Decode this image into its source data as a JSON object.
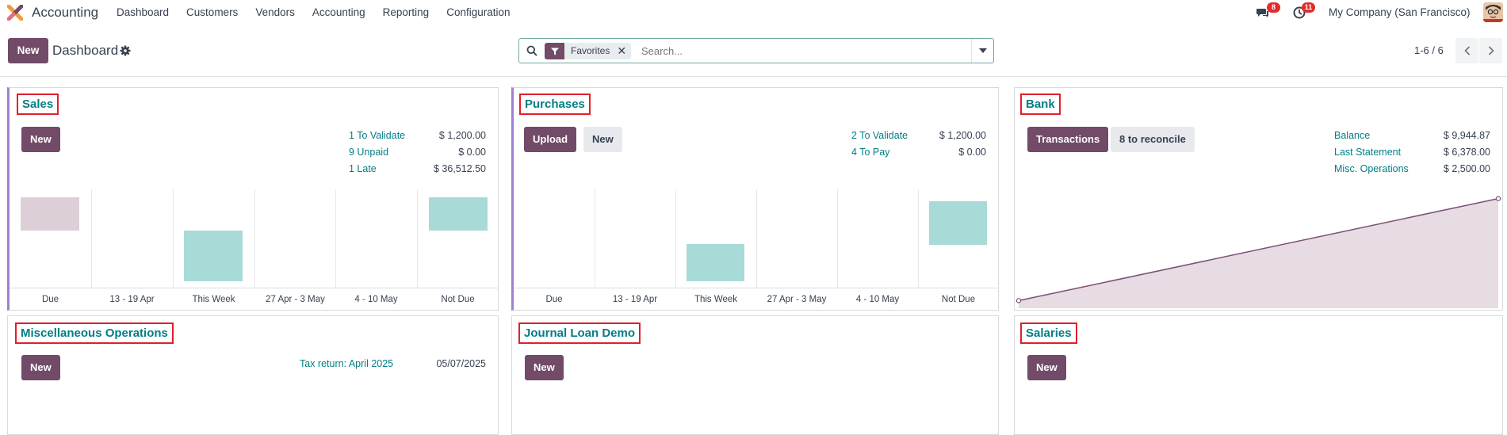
{
  "app": {
    "name": "Accounting",
    "menu": [
      "Dashboard",
      "Customers",
      "Vendors",
      "Accounting",
      "Reporting",
      "Configuration"
    ],
    "messages_count": "8",
    "activities_count": "11",
    "company": "My Company (San Francisco)"
  },
  "control": {
    "new_label": "New",
    "breadcrumb": "Dashboard",
    "facet_label": "Favorites",
    "search_placeholder": "Search...",
    "pager": "1-6 / 6"
  },
  "colors": {
    "brand": "#714b67",
    "link": "#017e84",
    "highlight_box": "#e0202a",
    "bar_past": "#dccfd8",
    "bar_future": "#a8dad8",
    "area_fill": "#e7dbe4",
    "line": "#7d4f73"
  },
  "cards": {
    "sales": {
      "title": "Sales",
      "new_label": "New",
      "stats": [
        {
          "label": "1 To Validate",
          "value": "$ 1,200.00"
        },
        {
          "label": "9 Unpaid",
          "value": "$ 0.00"
        },
        {
          "label": "1 Late",
          "value": "$ 36,512.50"
        }
      ]
    },
    "purchases": {
      "title": "Purchases",
      "upload_label": "Upload",
      "new_label": "New",
      "stats": [
        {
          "label": "2 To Validate",
          "value": "$ 1,200.00"
        },
        {
          "label": "4 To Pay",
          "value": "$ 0.00"
        }
      ]
    },
    "bank": {
      "title": "Bank",
      "transactions_label": "Transactions",
      "reconcile_label": "8 to reconcile",
      "stats": [
        {
          "label": "Balance",
          "value": "$ 9,944.87"
        },
        {
          "label": "Last Statement",
          "value": "$ 6,378.00"
        },
        {
          "label": "Misc. Operations",
          "value": "$ 2,500.00"
        }
      ]
    },
    "misc": {
      "title": "Miscellaneous Operations",
      "new_label": "New",
      "tax_label": "Tax return: April 2025",
      "tax_date": "05/07/2025"
    },
    "journal_loan": {
      "title": "Journal Loan Demo",
      "new_label": "New"
    },
    "salaries": {
      "title": "Salaries",
      "new_label": "New"
    }
  },
  "chart_data": [
    {
      "type": "bar",
      "chart": "sales",
      "categories": [
        "Due",
        "13 - 19 Apr",
        "This Week",
        "27 Apr - 3 May",
        "4 - 10 May",
        "Not Due"
      ],
      "bars": [
        {
          "category": "Due",
          "low": 0.58,
          "high": 0.92,
          "status": "past"
        },
        {
          "category": "This Week",
          "low": 0.06,
          "high": 0.58,
          "status": "future"
        },
        {
          "category": "Not Due",
          "low": 0.58,
          "high": 0.92,
          "status": "future"
        }
      ]
    },
    {
      "type": "bar",
      "chart": "purchases",
      "categories": [
        "Due",
        "13 - 19 Apr",
        "This Week",
        "27 Apr - 3 May",
        "4 - 10 May",
        "Not Due"
      ],
      "bars": [
        {
          "category": "This Week",
          "low": 0.06,
          "high": 0.44,
          "status": "future"
        },
        {
          "category": "Not Due",
          "low": 0.44,
          "high": 0.88,
          "status": "future"
        }
      ]
    },
    {
      "type": "area",
      "chart": "bank",
      "points": [
        {
          "x": 0,
          "y": 0.04
        },
        {
          "x": 1,
          "y": 0.96
        }
      ]
    }
  ]
}
